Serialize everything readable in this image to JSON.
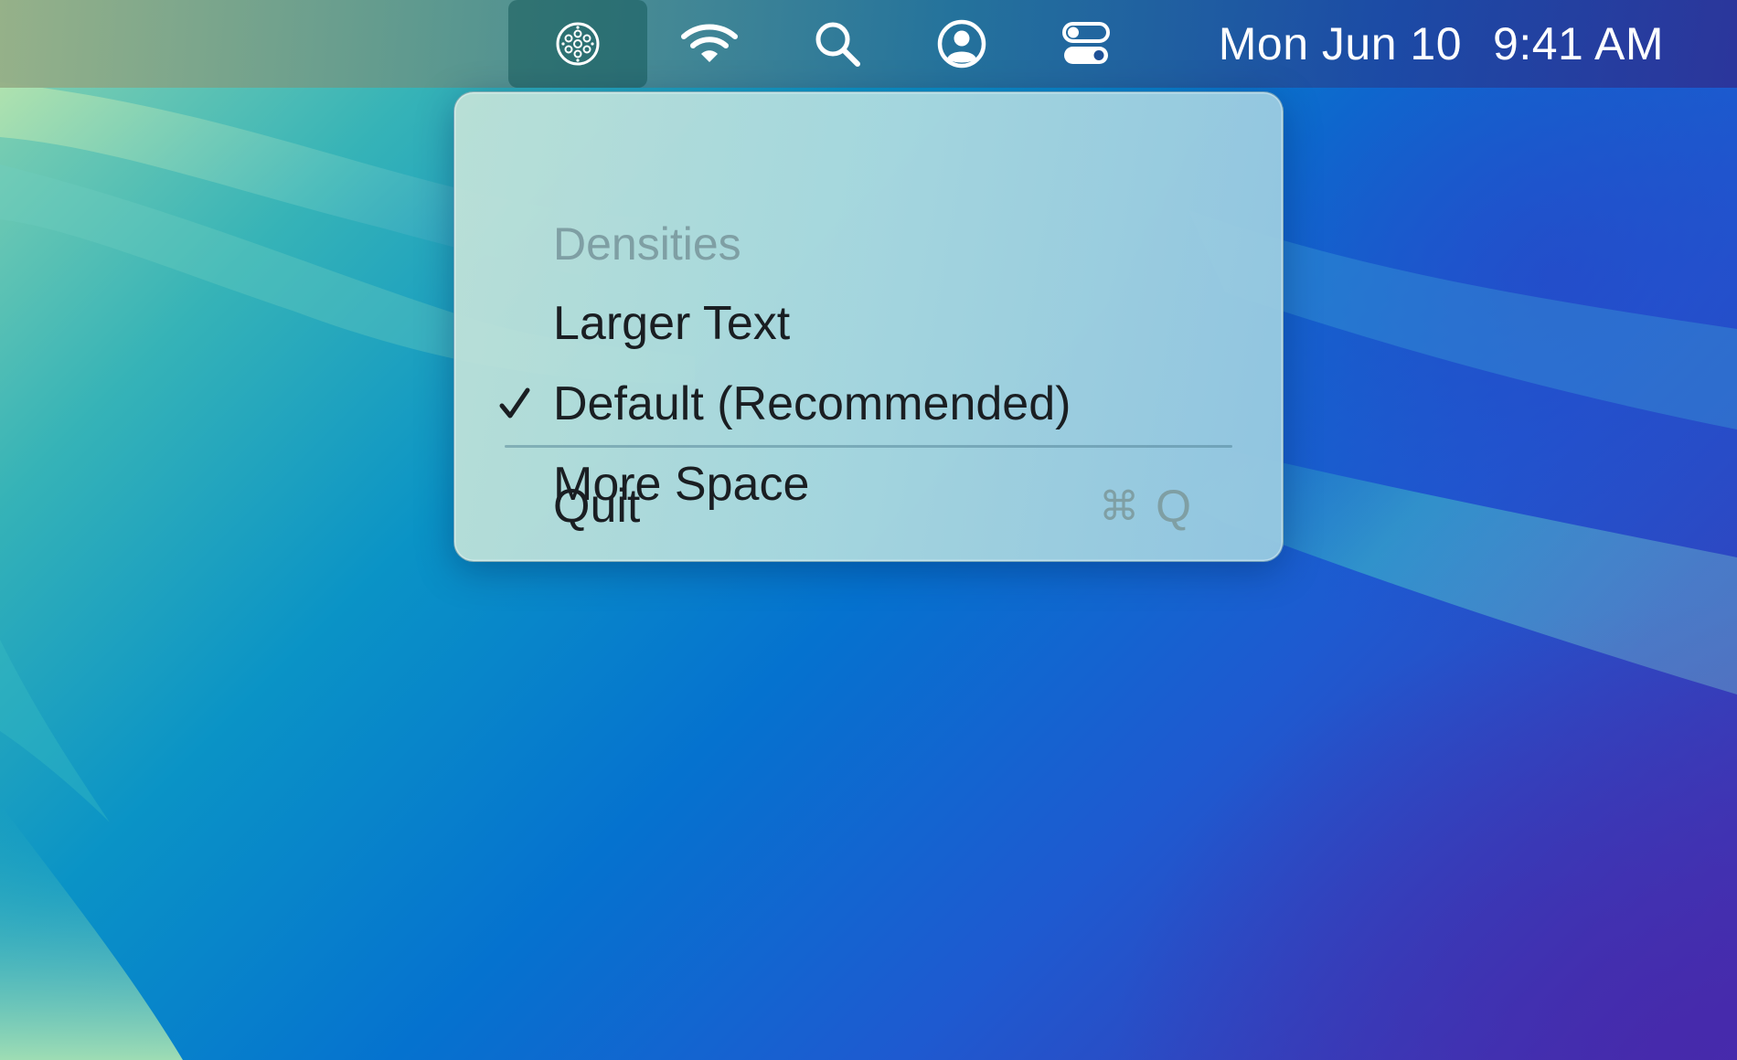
{
  "menubar": {
    "status_icons": [
      {
        "name": "densities-app-icon",
        "active": true
      },
      {
        "name": "wifi-icon",
        "active": false
      },
      {
        "name": "search-icon",
        "active": false
      },
      {
        "name": "user-icon",
        "active": false
      },
      {
        "name": "control-center-icon",
        "active": false
      }
    ],
    "date": "Mon Jun 10",
    "time": "9:41 AM"
  },
  "menu": {
    "header": "Densities",
    "items": [
      {
        "label": "Larger Text",
        "checked": false
      },
      {
        "label": "Default (Recommended)",
        "checked": true
      },
      {
        "label": "More Space",
        "checked": false
      }
    ],
    "quit": {
      "label": "Quit",
      "shortcut_symbol": "⌘",
      "shortcut_key": "Q"
    }
  },
  "colors": {
    "menu_text": "#1a1e22",
    "disabled_text": "#7f9fa4",
    "menubar_text": "#ffffff"
  }
}
